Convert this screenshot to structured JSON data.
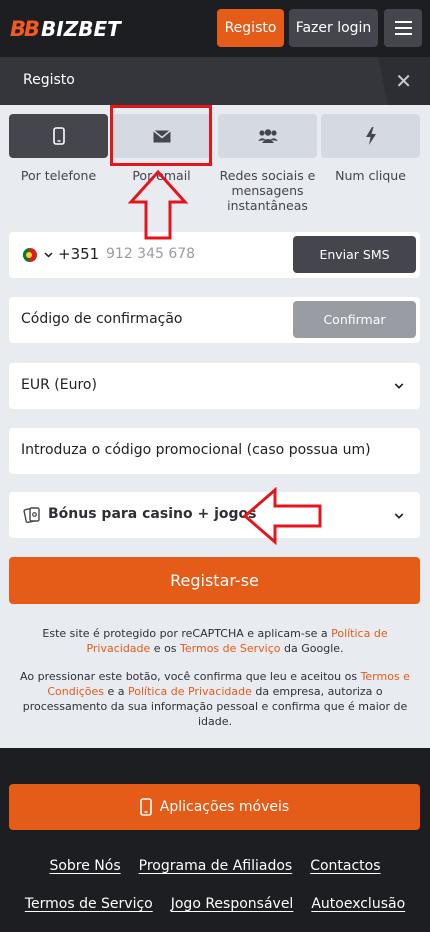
{
  "header": {
    "logo_mark": "BB",
    "logo_text": "BIZBET",
    "register_label": "Registo",
    "login_label": "Fazer login",
    "menu_icon": "hamburger-icon"
  },
  "titlebar": {
    "title": "Registo",
    "close_icon": "close-icon"
  },
  "tabs": [
    {
      "label": "Por telefone",
      "icon": "phone-icon",
      "active": true
    },
    {
      "label": "Por email",
      "icon": "envelope-icon",
      "active": false
    },
    {
      "label": "Redes sociais e mensagens instantâneas",
      "icon": "users-icon",
      "active": false
    },
    {
      "label": "Num clique",
      "icon": "lightning-icon",
      "active": false
    }
  ],
  "phone": {
    "country_code": "+351",
    "placeholder": "912 345 678",
    "send_sms_label": "Enviar SMS"
  },
  "confirmation": {
    "placeholder": "Código de confirmação",
    "confirm_label": "Confirmar"
  },
  "currency": {
    "selected": "EUR (Euro)"
  },
  "promo": {
    "placeholder": "Introduza o código promocional (caso possua um)"
  },
  "bonus": {
    "selected": "Bónus para casino + jogos"
  },
  "register_button": "Registar-se",
  "recaptcha_notice": {
    "prefix": "Este site é protegido por reCAPTCHA e aplicam-se a ",
    "privacy_link": "Política de Privacidade",
    "middle": " e os ",
    "terms_link": "Termos de Serviço",
    "suffix": " da Google."
  },
  "consent_notice": {
    "prefix": "Ao pressionar este botão, você confirma que leu e aceitou os ",
    "terms_link": "Termos e Condições",
    "middle": " e a ",
    "privacy_link": "Política de Privacidade",
    "suffix": " da empresa, autoriza o processamento da sua informação pessoal e confirma que é maior de idade."
  },
  "footer": {
    "apps_label": "Aplicações móveis",
    "links_row1": [
      "Sobre Nós",
      "Programa de Afiliados",
      "Contactos"
    ],
    "links_row2": [
      "Termos de Serviço",
      "Jogo Responsável",
      "Autoexclusão"
    ]
  },
  "colors": {
    "accent": "#e55b18",
    "dark": "#1d1e22",
    "form_bg": "#e8ebf0",
    "annotation": "#e5151b"
  }
}
